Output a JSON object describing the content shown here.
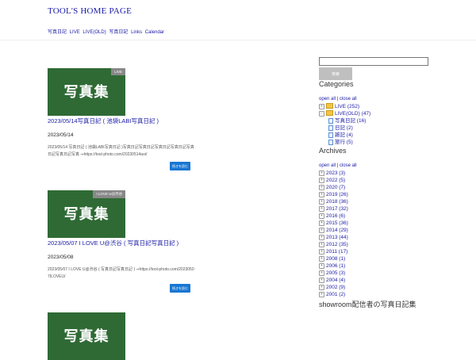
{
  "header": {
    "site_title": "TOOL'S HOME PAGE",
    "nav": [
      "写真日記",
      "LIVE",
      "LIVE(OLD)",
      "写真日記",
      "Links",
      "Calendar"
    ]
  },
  "posts": [
    {
      "thumb_text": "写真集",
      "category": "LIVE",
      "title": "2023/05/14写真日記 ( 池袋LABI写真日記 )",
      "date": "2023/05/14",
      "excerpt": "2023/05/14 写真日記 ( 池袋LABI写真日記 )写真日記写真日記写真日記写真日記写真日記写真日記写真 ⇒https://tool-photo.com/20230514aoi/",
      "more_label": "続きを読む"
    },
    {
      "thumb_text": "写真集",
      "category": "I LOVE U@渋谷",
      "title": "2023/05/07 I LOVE U@渋谷 ( 写真日記写真日記 )",
      "date": "2023/05/08",
      "excerpt": "2023/05/07 I LOVE U@渋谷 ( 写真日記写真日記 ) ⇒https://tool-photo.com/20230507ILOVEU/",
      "more_label": "続きを読む"
    },
    {
      "thumb_text": "写真集",
      "category": ""
    }
  ],
  "sidebar": {
    "search_placeholder": "",
    "search_button": "検索",
    "categories_title": "Categories",
    "categories_toggle": "open all | close all",
    "categories": [
      {
        "label": "LIVE (252)",
        "level": 0,
        "type": "folder",
        "sign": "+"
      },
      {
        "label": "LIVE(OLD) (47)",
        "level": 0,
        "type": "folder",
        "sign": "−"
      },
      {
        "label": "写真日記 (16)",
        "level": 1,
        "type": "page"
      },
      {
        "label": "日記 (2)",
        "level": 1,
        "type": "page"
      },
      {
        "label": "雑記 (4)",
        "level": 1,
        "type": "page"
      },
      {
        "label": "旅行 (5)",
        "level": 1,
        "type": "page"
      }
    ],
    "archives_title": "Archives",
    "archives_toggle": "open all | close all",
    "archives": [
      "2023 (3)",
      "2022 (5)",
      "2020 (7)",
      "2019 (26)",
      "2018 (36)",
      "2017 (32)",
      "2016 (6)",
      "2015 (36)",
      "2014 (29)",
      "2013 (44)",
      "2012 (35)",
      "2011 (17)",
      "2008 (1)",
      "2006 (1)",
      "2005 (3)",
      "2004 (4)",
      "2002 (9)",
      "2001 (2)"
    ],
    "showroom_title": "showroom配信者の写真日記集"
  },
  "colors": {
    "link": "#1a1aa6",
    "thumb_bg": "#2f6a35",
    "button": "#1976d2",
    "search_button": "#bfbfbf"
  }
}
